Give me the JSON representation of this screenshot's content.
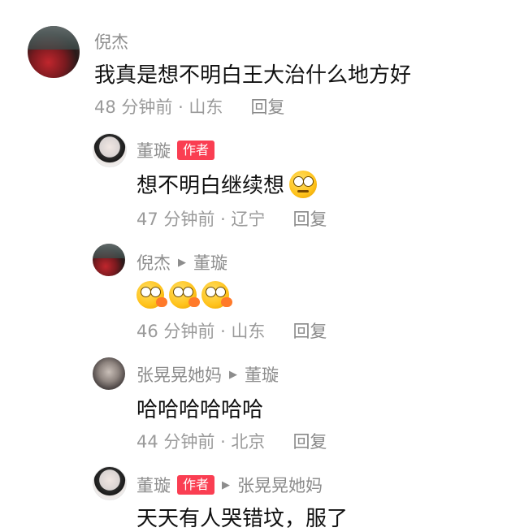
{
  "comments": [
    {
      "name": "倪杰",
      "text": "我真是想不明白王大治什么地方好",
      "meta": "48 分钟前 · 山东",
      "reply": "回复"
    },
    {
      "name": "董璇",
      "badge": "作者",
      "text": "想不明白继续想",
      "meta": "47 分钟前 · 辽宁",
      "reply": "回复"
    },
    {
      "name": "倪杰",
      "target": "董璇",
      "meta": "46 分钟前 · 山东",
      "reply": "回复",
      "emojis": [
        "surprised-emoji",
        "surprised-emoji",
        "surprised-emoji"
      ]
    },
    {
      "name": "张晃晃她妈",
      "target": "董璇",
      "text": "哈哈哈哈哈哈",
      "meta": "44 分钟前 · 北京",
      "reply": "回复"
    },
    {
      "name": "董璇",
      "badge": "作者",
      "target": "张晃晃她妈",
      "text": "天天有人哭错坟，服了"
    }
  ],
  "icons": {
    "reply_arrow": "triangle-right-icon",
    "thinking_emoji": "thinking-face-emoji"
  },
  "colors": {
    "author_badge": "#fa3e52",
    "meta_text": "#9a9a9a",
    "name_text": "#8d8d8d"
  }
}
